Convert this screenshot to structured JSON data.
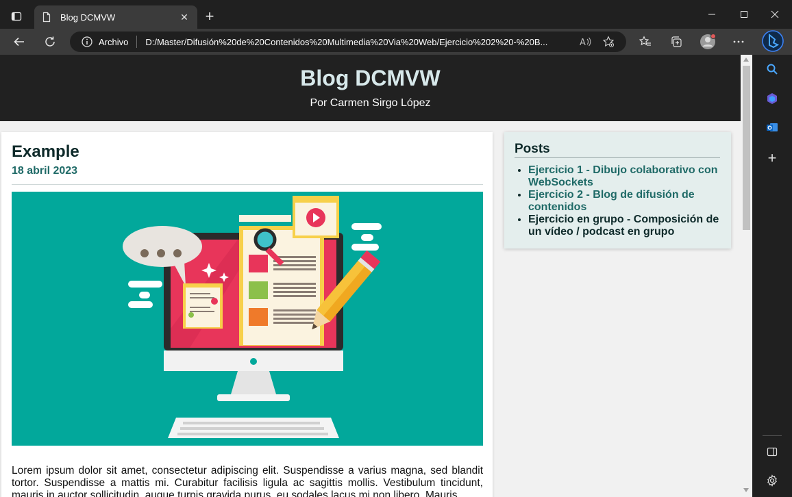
{
  "browser": {
    "tab_title": "Blog DCMVW",
    "address_label": "Archivo",
    "url": "D:/Master/Difusi%C3%B3n%20de%20Contenidos%20Multimedia%20Via%20Web/Ejercicio%202%20-%20B...",
    "url_display": "D:/Master/Difusión%20de%20Contenidos%20Multimedia%20Via%20Web/Ejercicio%202%20-%20B..."
  },
  "site": {
    "title": "Blog DCMVW",
    "subtitle": "Por Carmen Sirgo López"
  },
  "post": {
    "title": "Example",
    "date": "18 abril 2023",
    "body": "Lorem ipsum dolor sit amet, consectetur adipiscing elit. Suspendisse a varius magna, sed blandit tortor. Suspendisse a mattis mi. Curabitur facilisis ligula ac sagittis mollis. Vestibulum tincidunt, mauris in auctor sollicitudin, augue turpis gravida purus, eu sodales lacus mi non libero. Mauris"
  },
  "sidebar": {
    "heading": "Posts",
    "items": [
      {
        "label": "Ejercicio 1 - Dibujo colaborativo con WebSockets",
        "link": true
      },
      {
        "label": "Ejercicio 2 - Blog de difusión de contenidos",
        "link": true
      },
      {
        "label": "Ejercicio en grupo - Composición de un vídeo / podcast en grupo",
        "link": false
      }
    ]
  },
  "colors": {
    "header_bg": "#212121",
    "title_color": "#d7e8ea",
    "accent": "#1f6a67",
    "image_bg": "#02a89b"
  }
}
